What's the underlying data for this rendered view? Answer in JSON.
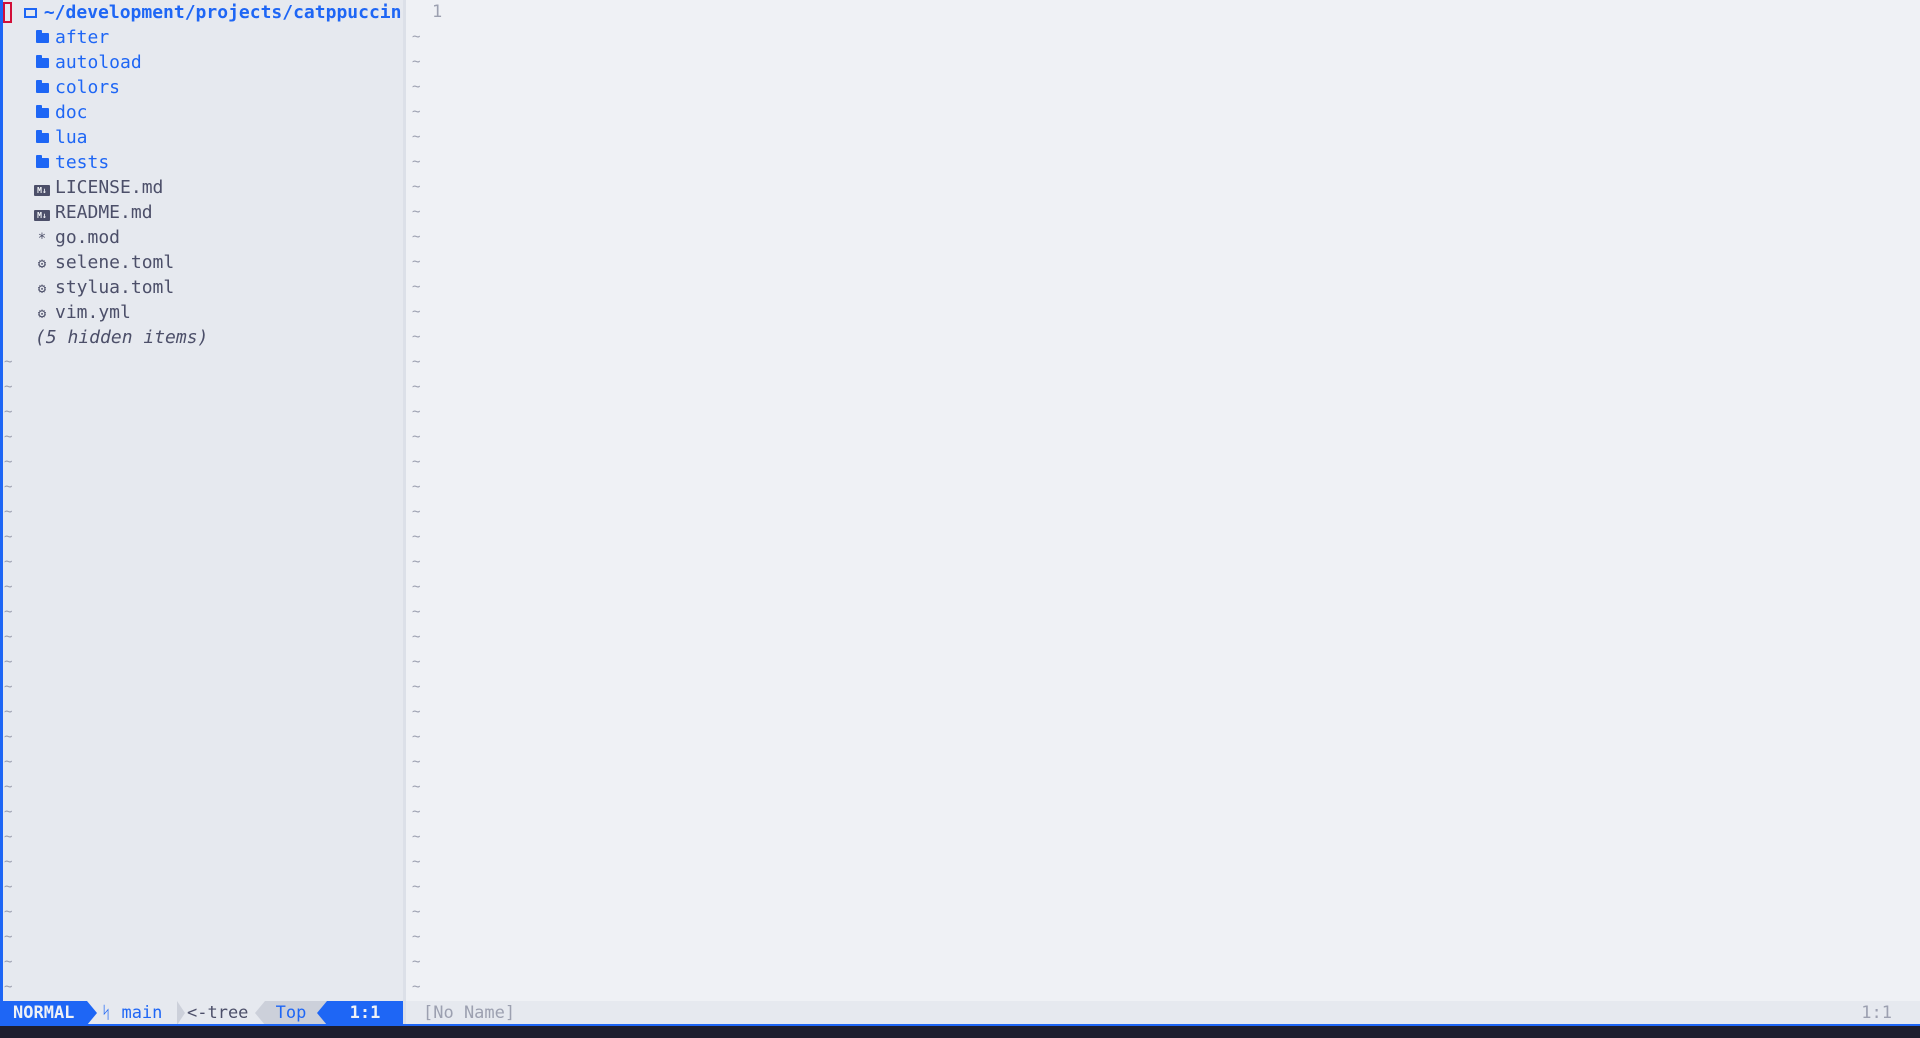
{
  "tree": {
    "root_path": "~/development/projects/catppuccin-nvim",
    "folders": [
      {
        "name": "after"
      },
      {
        "name": "autoload"
      },
      {
        "name": "colors"
      },
      {
        "name": "doc"
      },
      {
        "name": "lua"
      },
      {
        "name": "tests"
      }
    ],
    "files": [
      {
        "name": "LICENSE.md",
        "icon": "markdown-icon",
        "glyph": "M↓"
      },
      {
        "name": "README.md",
        "icon": "markdown-icon",
        "glyph": "M↓"
      },
      {
        "name": "go.mod",
        "icon": "asterisk-icon",
        "glyph": "*"
      },
      {
        "name": "selene.toml",
        "icon": "gear-icon",
        "glyph": "⚙"
      },
      {
        "name": "stylua.toml",
        "icon": "gear-icon",
        "glyph": "⚙"
      },
      {
        "name": "vim.yml",
        "icon": "gear-icon",
        "glyph": "⚙"
      }
    ],
    "hidden_note": "(5 hidden items)",
    "tilde": "~"
  },
  "editor": {
    "line_number": "1",
    "tilde": "~"
  },
  "statusline": {
    "mode": "NORMAL",
    "branch_icon": "ᛋ",
    "branch": "main",
    "file": "<-tree",
    "scroll": "Top",
    "position": "1:1"
  },
  "buffer": {
    "name": "[No Name]",
    "position": "1:1"
  },
  "colors": {
    "accent": "#1e66f5",
    "background": "#eff1f5",
    "sidebar_bg": "#e6e9ef",
    "text": "#4c4f69",
    "muted": "#9ca0b0",
    "cursor": "#d20f39"
  }
}
